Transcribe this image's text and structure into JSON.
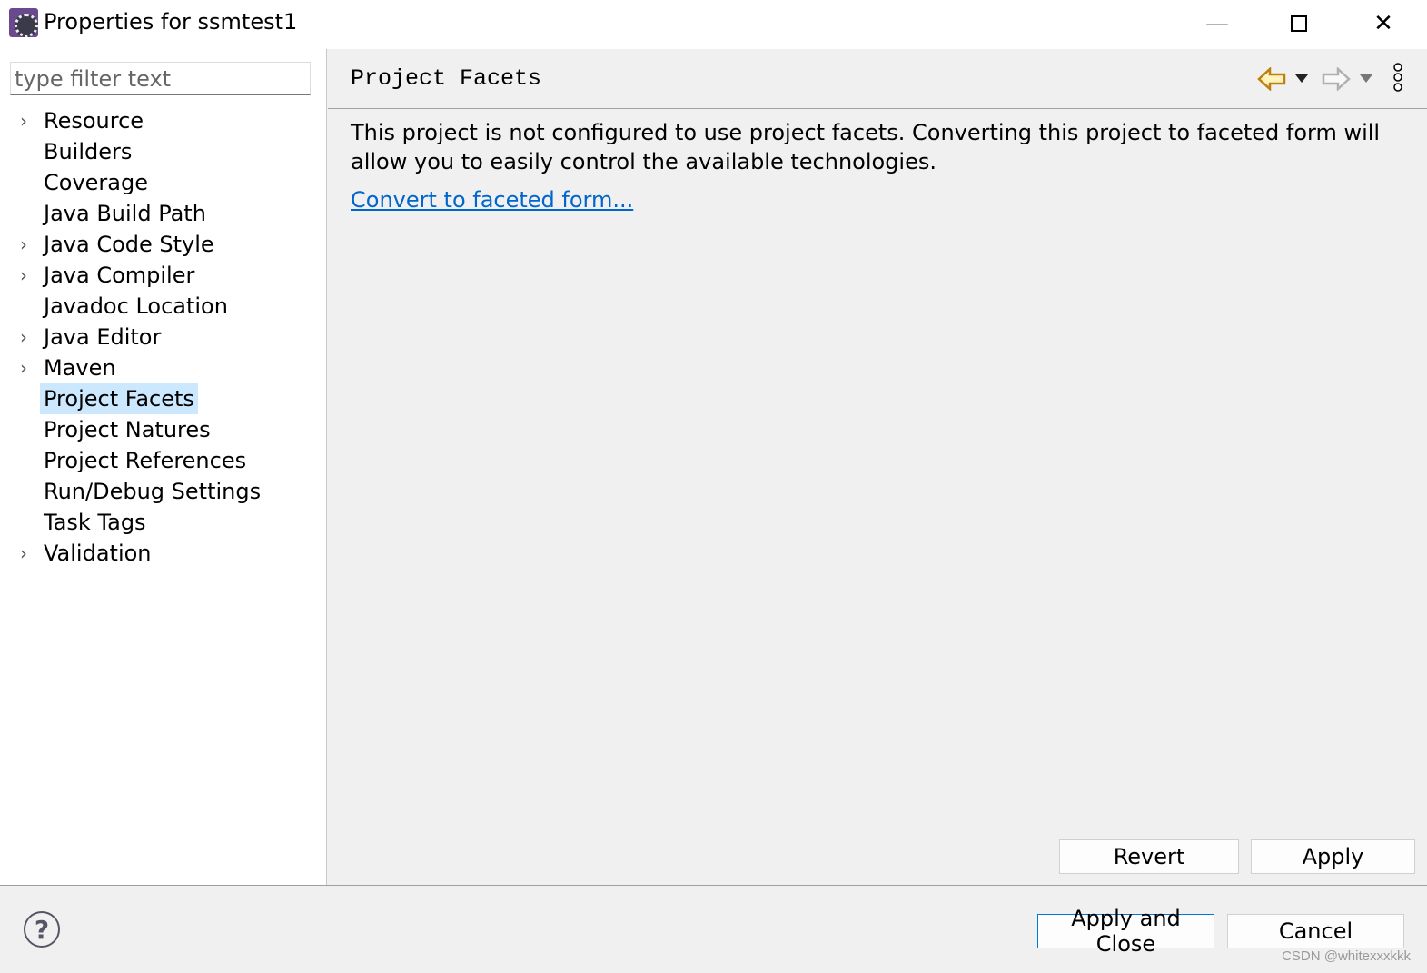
{
  "window": {
    "title": "Properties for ssmtest1",
    "minimize_icon": "minimize-icon",
    "maximize_icon": "maximize-icon",
    "close_icon": "close-icon"
  },
  "filter": {
    "placeholder": "type filter text",
    "value": ""
  },
  "tree": [
    {
      "label": "Resource",
      "expandable": true
    },
    {
      "label": "Builders",
      "expandable": false
    },
    {
      "label": "Coverage",
      "expandable": false
    },
    {
      "label": "Java Build Path",
      "expandable": false
    },
    {
      "label": "Java Code Style",
      "expandable": true
    },
    {
      "label": "Java Compiler",
      "expandable": true
    },
    {
      "label": "Javadoc Location",
      "expandable": false
    },
    {
      "label": "Java Editor",
      "expandable": true
    },
    {
      "label": "Maven",
      "expandable": true
    },
    {
      "label": "Project Facets",
      "expandable": false,
      "selected": true
    },
    {
      "label": "Project Natures",
      "expandable": false
    },
    {
      "label": "Project References",
      "expandable": false
    },
    {
      "label": "Run/Debug Settings",
      "expandable": false
    },
    {
      "label": "Task Tags",
      "expandable": false
    },
    {
      "label": "Validation",
      "expandable": true
    }
  ],
  "page": {
    "title": "Project Facets",
    "message": "This project is not configured to use project facets. Converting this project to faceted form will allow you to easily control the available technologies.",
    "link": "Convert to faceted form..."
  },
  "buttons": {
    "revert": "Revert",
    "apply": "Apply",
    "apply_close": "Apply and Close",
    "cancel": "Cancel"
  },
  "watermark": "CSDN @whitexxxkkk",
  "colors": {
    "link": "#0066cc",
    "selection": "#cce8ff",
    "back_arrow": "#e0a020"
  }
}
